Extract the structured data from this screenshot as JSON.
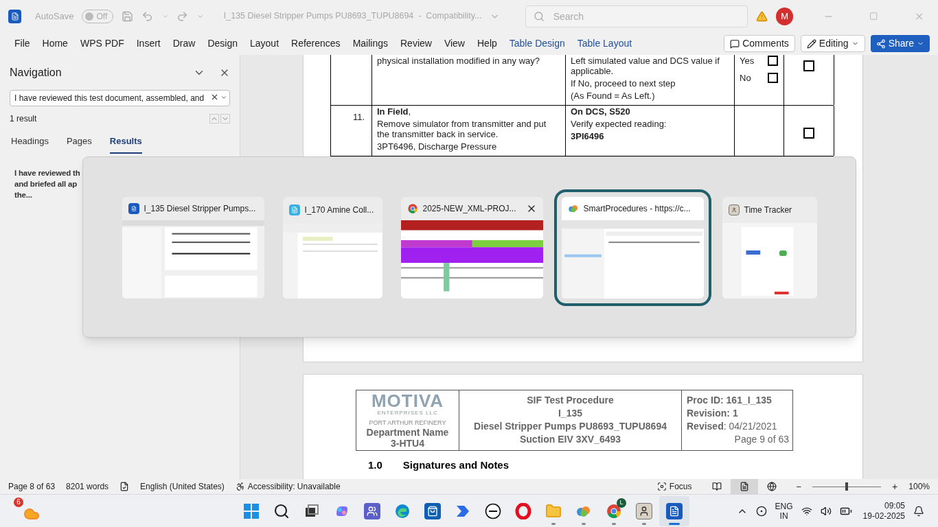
{
  "title_bar": {
    "autosave_label": "AutoSave",
    "autosave": {
      "on": false,
      "label": "Off"
    },
    "document_title": "I_135 Diesel Stripper Pumps PU8693_TUPU8694  -  Compatibility...",
    "search": {
      "placeholder": "Search"
    },
    "avatar": "M"
  },
  "ribbon": {
    "tabs": [
      {
        "label": "File",
        "kind": "plain"
      },
      {
        "label": "Home",
        "kind": "plain"
      },
      {
        "label": "WPS PDF",
        "kind": "plain"
      },
      {
        "label": "Insert",
        "kind": "plain"
      },
      {
        "label": "Draw",
        "kind": "plain"
      },
      {
        "label": "Design",
        "kind": "plain"
      },
      {
        "label": "Layout",
        "kind": "plain"
      },
      {
        "label": "References",
        "kind": "plain"
      },
      {
        "label": "Mailings",
        "kind": "plain"
      },
      {
        "label": "Review",
        "kind": "plain"
      },
      {
        "label": "View",
        "kind": "plain"
      },
      {
        "label": "Help",
        "kind": "plain"
      },
      {
        "label": "Table Design",
        "kind": "contextual"
      },
      {
        "label": "Table Layout",
        "kind": "contextual"
      }
    ],
    "comments": "Comments",
    "editing": "Editing",
    "share": "Share"
  },
  "navigation": {
    "title": "Navigation",
    "search_value": "I have reviewed this test document, assembled, and",
    "result_count": "1 result",
    "tabs": [
      {
        "label": "Headings",
        "selected": false
      },
      {
        "label": "Pages",
        "selected": false
      },
      {
        "label": "Results",
        "selected": true
      }
    ],
    "result_lines": [
      "I have reviewed th",
      "and briefed all ap",
      "the..."
    ]
  },
  "document": {
    "rows": [
      {
        "description": [
          {
            "text": "physical installation modified in any way?",
            "bold": false
          }
        ],
        "action": [
          {
            "text": "Left  simulated value and DCS value if applicable.",
            "bold": false
          },
          {
            "text": "If No, proceed to next step",
            "bold": false
          },
          {
            "text": "(As Found = As Left.)",
            "bold": false
          }
        ],
        "options": [
          {
            "label": "Yes",
            "checked": false
          },
          {
            "label": "No",
            "checked": false
          }
        ],
        "done": {
          "checked": false
        }
      },
      {
        "step": "11.",
        "description": [
          {
            "text": "**In Field**,",
            "bold": false
          },
          {
            "text": "Remove simulator from transmitter and put the transmitter back in service.",
            "bold": false
          },
          {
            "text": "3PT6496, Discharge Pressure",
            "bold": false
          }
        ],
        "action": [
          {
            "text": "On DCS, S520",
            "bold": true
          },
          {
            "text": "Verify expected reading:",
            "bold": false
          },
          {
            "text": "3PI6496",
            "bold": true
          }
        ],
        "done": {
          "checked": false
        }
      }
    ],
    "footer": {
      "logo": "MOTIVA",
      "logo_sub": "ENTERPRISES LLC",
      "site": "PORT ARTHUR REFINERY",
      "department": [
        "Department Name",
        "3-HTU4"
      ],
      "center": [
        "SIF Test Procedure",
        "I_135",
        "Diesel Stripper Pumps PU8693_TUPU8694",
        "Suction EIV 3XV_6493"
      ],
      "right": [
        "**Proc ID: 161_I_135**",
        "**Revision: 1**",
        "**Revised**: 04/21/2021"
      ],
      "page": "Page 9 of 63"
    },
    "next_heading": {
      "number": "1.0",
      "title": "Signatures and Notes"
    }
  },
  "task_switcher": {
    "windows": [
      {
        "title": "I_135 Diesel Stripper Pumps...",
        "kind": "word",
        "selected": false,
        "close_button": false
      },
      {
        "title": "I_170 Amine Coll...",
        "kind": "sheet",
        "selected": false,
        "close_button": false
      },
      {
        "title": "2025-NEW_XML-PROJ...",
        "kind": "chrome",
        "selected": false,
        "close_button": true
      },
      {
        "title": "SmartProcedures - https://c...",
        "kind": "cloud",
        "selected": true,
        "close_button": false
      },
      {
        "title": "Time Tracker",
        "kind": "tracker",
        "selected": false,
        "close_button": false
      }
    ]
  },
  "status_bar": {
    "page": "Page 8 of 63",
    "words": "8201 words",
    "language": "English (United States)",
    "accessibility": "Accessibility: Unavailable",
    "focus": "Focus",
    "views": [
      {
        "kind": "read",
        "selected": false
      },
      {
        "kind": "print",
        "selected": true
      },
      {
        "kind": "web",
        "selected": false
      }
    ],
    "zoom": {
      "level": 0.5,
      "zoom_out": "−",
      "zoom_in": "+",
      "reading": "100%"
    }
  },
  "taskbar": {
    "weather_badge": "6",
    "apps": [
      {
        "kind": "start",
        "running": false,
        "selected": false
      },
      {
        "kind": "search",
        "running": false,
        "selected": false
      },
      {
        "kind": "taskview",
        "running": false,
        "selected": false
      },
      {
        "kind": "copilot",
        "running": false,
        "selected": false
      },
      {
        "kind": "teams",
        "running": false,
        "selected": false
      },
      {
        "kind": "edge",
        "running": false,
        "selected": false
      },
      {
        "kind": "store",
        "running": false,
        "selected": false
      },
      {
        "kind": "automate",
        "running": false,
        "selected": false
      },
      {
        "kind": "dell",
        "running": false,
        "selected": false
      },
      {
        "kind": "opera",
        "running": false,
        "selected": false
      },
      {
        "kind": "files",
        "running": true,
        "selected": false
      },
      {
        "kind": "cloud",
        "running": true,
        "selected": false
      },
      {
        "kind": "chrome",
        "running": true,
        "selected": false,
        "badge": "L"
      },
      {
        "kind": "tracker",
        "running": true,
        "selected": false
      },
      {
        "kind": "word",
        "running": true,
        "selected": true
      }
    ],
    "language": "ENG",
    "region": "IN",
    "time": "09:05",
    "date": "19-02-2025"
  }
}
